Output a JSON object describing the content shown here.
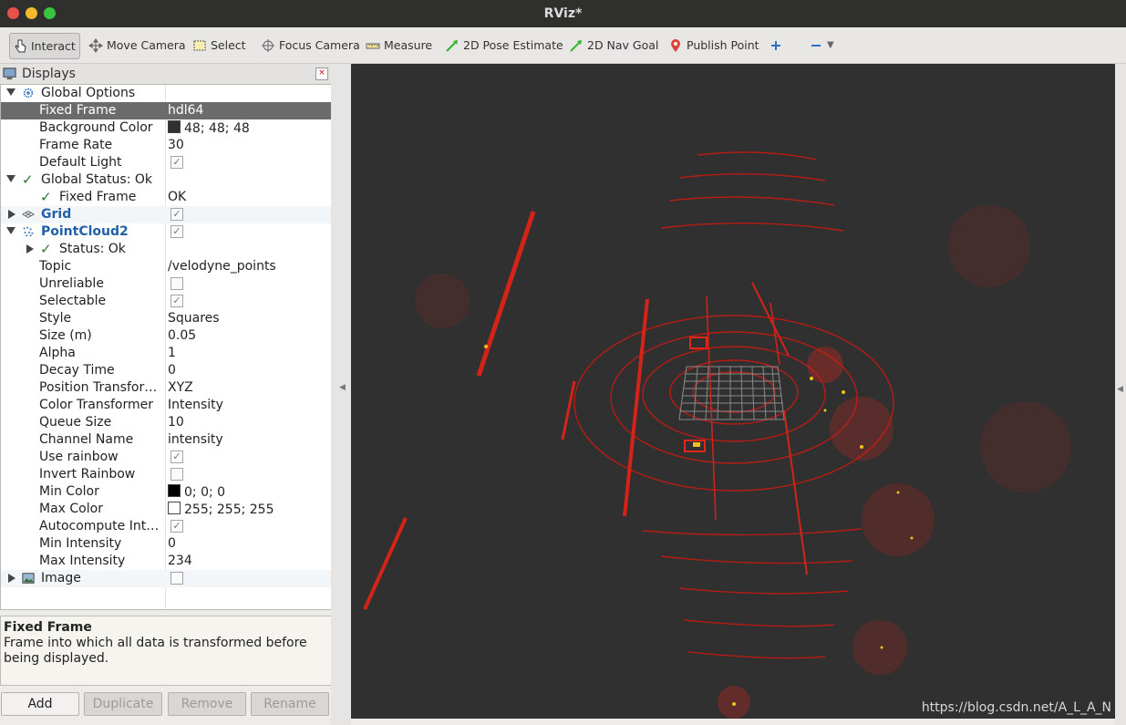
{
  "window": {
    "title": "RViz*"
  },
  "toolbar": {
    "interact": "Interact",
    "move_camera": "Move Camera",
    "select": "Select",
    "focus_camera": "Focus Camera",
    "measure": "Measure",
    "pose_estimate": "2D Pose Estimate",
    "nav_goal": "2D Nav Goal",
    "publish_point": "Publish Point"
  },
  "displays": {
    "title": "Displays",
    "rows": {
      "global_options": "Global Options",
      "fixed_frame_k": "Fixed Frame",
      "fixed_frame_v": "hdl64",
      "bg_color_k": "Background Color",
      "bg_color_v": "48; 48; 48",
      "frame_rate_k": "Frame Rate",
      "frame_rate_v": "30",
      "default_light_k": "Default Light",
      "global_status": "Global Status: Ok",
      "gs_fixed_frame_k": "Fixed Frame",
      "gs_fixed_frame_v": "OK",
      "grid": "Grid",
      "pointcloud2": "PointCloud2",
      "status_ok": "Status: Ok",
      "topic_k": "Topic",
      "topic_v": "/velodyne_points",
      "unreliable_k": "Unreliable",
      "selectable_k": "Selectable",
      "style_k": "Style",
      "style_v": "Squares",
      "size_k": "Size (m)",
      "size_v": "0.05",
      "alpha_k": "Alpha",
      "alpha_v": "1",
      "decay_k": "Decay Time",
      "decay_v": "0",
      "pos_tf_k": "Position Transfor…",
      "pos_tf_v": "XYZ",
      "color_tf_k": "Color Transformer",
      "color_tf_v": "Intensity",
      "queue_k": "Queue Size",
      "queue_v": "10",
      "channel_k": "Channel Name",
      "channel_v": "intensity",
      "rainbow_k": "Use rainbow",
      "invert_k": "Invert Rainbow",
      "min_color_k": "Min Color",
      "min_color_v": "0; 0; 0",
      "max_color_k": "Max Color",
      "max_color_v": "255; 255; 255",
      "autocomp_k": "Autocompute Int…",
      "min_int_k": "Min Intensity",
      "min_int_v": "0",
      "max_int_k": "Max Intensity",
      "max_int_v": "234",
      "image": "Image"
    },
    "colors": {
      "background": "#303030",
      "min": "#000000",
      "max": "#ffffff"
    }
  },
  "description": {
    "title": "Fixed Frame",
    "text": "Frame into which all data is transformed before being displayed."
  },
  "buttons": {
    "add": "Add",
    "duplicate": "Duplicate",
    "remove": "Remove",
    "rename": "Rename"
  },
  "watermark": "https://blog.csdn.net/A_L_A_N"
}
